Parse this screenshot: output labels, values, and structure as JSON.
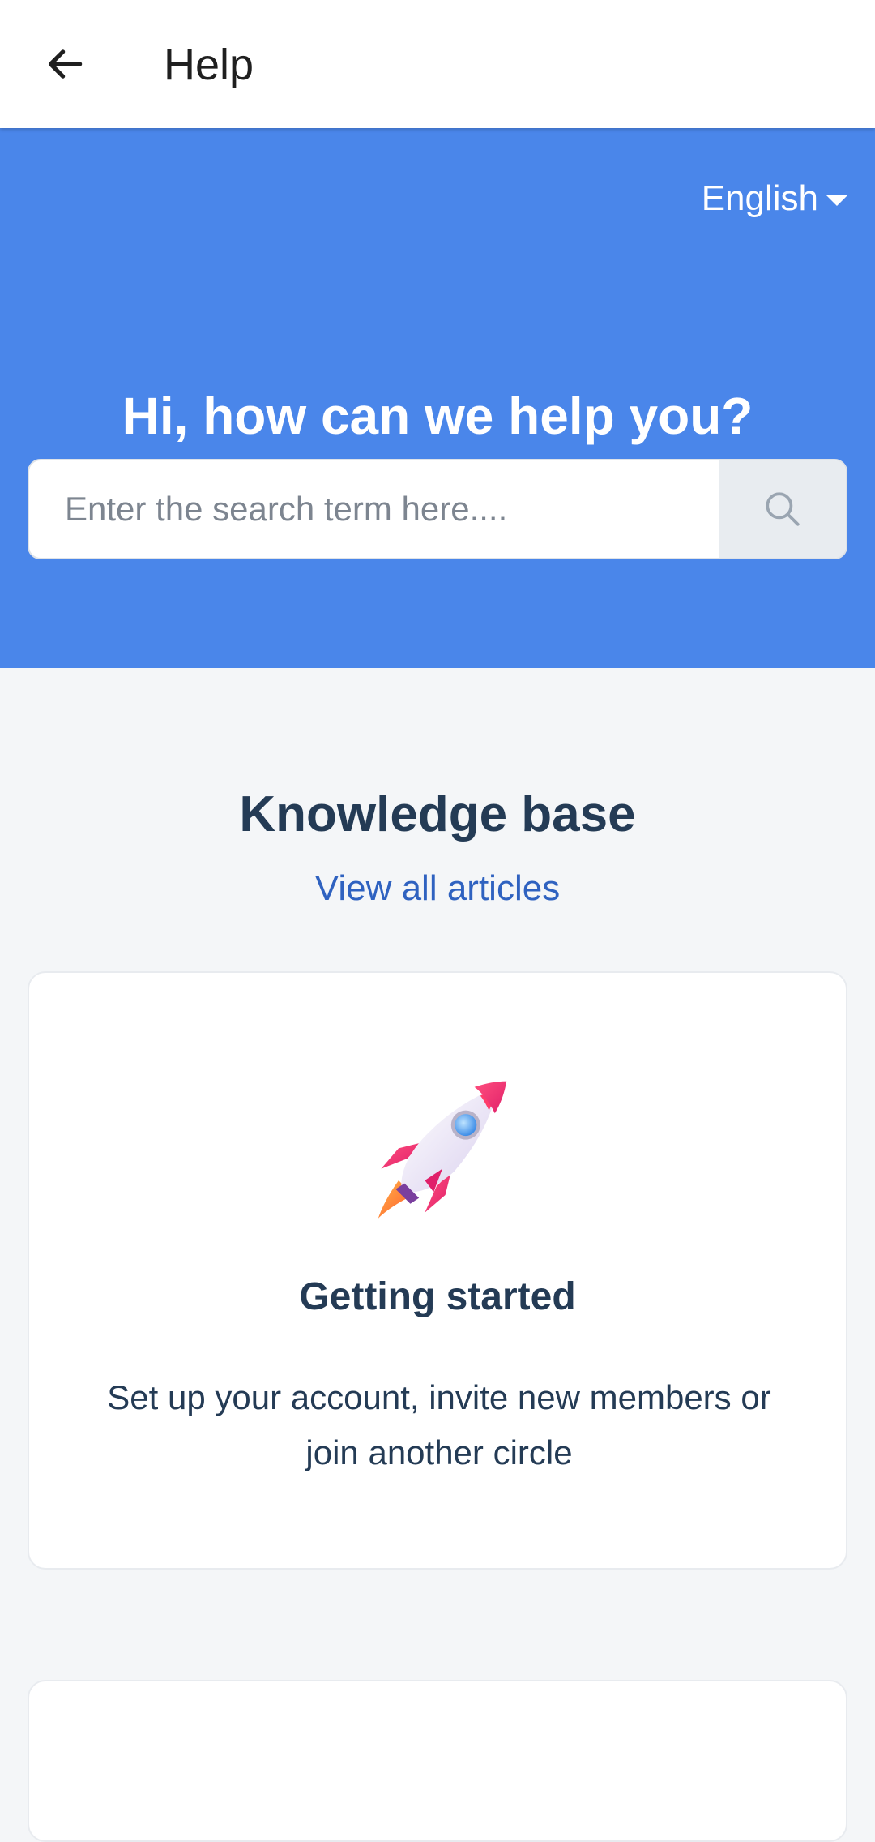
{
  "app_bar": {
    "title": "Help",
    "back_icon": "arrow-left-icon"
  },
  "hero": {
    "language": "English",
    "heading": "Hi, how can we help you?",
    "search_placeholder": "Enter the search term here....",
    "search_value": "",
    "search_icon": "search-icon",
    "background_color": "#4a86ea"
  },
  "knowledge_base": {
    "title": "Knowledge base",
    "view_all_label": "View all articles",
    "categories": [
      {
        "icon": "rocket-icon",
        "title": "Getting started",
        "description": "Set up your account, invite new members or join another circle"
      }
    ]
  },
  "colors": {
    "accent": "#4a86ea",
    "heading": "#243b55",
    "link": "#2f62c0"
  }
}
